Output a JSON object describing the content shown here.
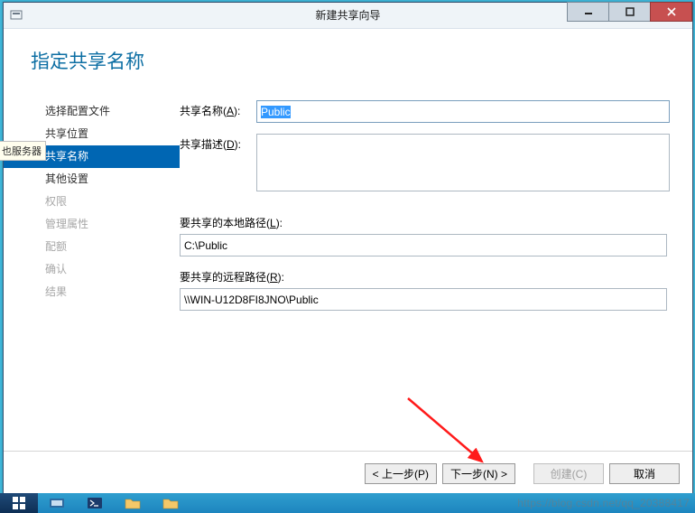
{
  "titlebar": {
    "title": "新建共享向导"
  },
  "heading": "指定共享名称",
  "floating_tip": "也服务器",
  "sidebar": {
    "steps": [
      {
        "label": "选择配置文件",
        "state": "done"
      },
      {
        "label": "共享位置",
        "state": "done"
      },
      {
        "label": "共享名称",
        "state": "active"
      },
      {
        "label": "其他设置",
        "state": "done"
      },
      {
        "label": "权限",
        "state": "disabled"
      },
      {
        "label": "管理属性",
        "state": "disabled"
      },
      {
        "label": "配额",
        "state": "disabled"
      },
      {
        "label": "确认",
        "state": "disabled"
      },
      {
        "label": "结果",
        "state": "disabled"
      }
    ]
  },
  "form": {
    "share_name_label_pre": "共享名称(",
    "share_name_key": "A",
    "share_name_label_post": "):",
    "share_name_value": "Public",
    "share_desc_label_pre": "共享描述(",
    "share_desc_key": "D",
    "share_desc_label_post": "):",
    "share_desc_value": "",
    "local_path_label_pre": "要共享的本地路径(",
    "local_path_key": "L",
    "local_path_label_post": "):",
    "local_path_value": "C:\\Public",
    "remote_path_label_pre": "要共享的远程路径(",
    "remote_path_key": "R",
    "remote_path_label_post": "):",
    "remote_path_value": "\\\\WIN-U12D8FI8JNO\\Public"
  },
  "footer": {
    "prev": "< 上一步(P)",
    "next": "下一步(N) >",
    "create": "创建(C)",
    "cancel": "取消"
  },
  "watermark": "https://blog.csdn.net/qq_20388417"
}
